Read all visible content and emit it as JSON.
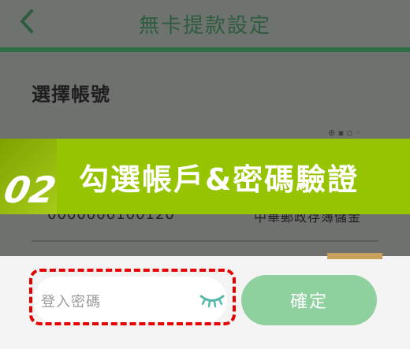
{
  "header": {
    "title": "無卡提款設定"
  },
  "section": {
    "title": "選擇帳號"
  },
  "account": {
    "fragment": "0000000100120",
    "type": "中華郵政存簿儲金"
  },
  "banner": {
    "step": "02",
    "text": "勾選帳戶&密碼驗證"
  },
  "form": {
    "password_placeholder": "登入密碼",
    "confirm_label": "確定"
  },
  "colors": {
    "banner": "#96c400",
    "confirm": "#8fd19e",
    "highlight": "#e60000"
  }
}
